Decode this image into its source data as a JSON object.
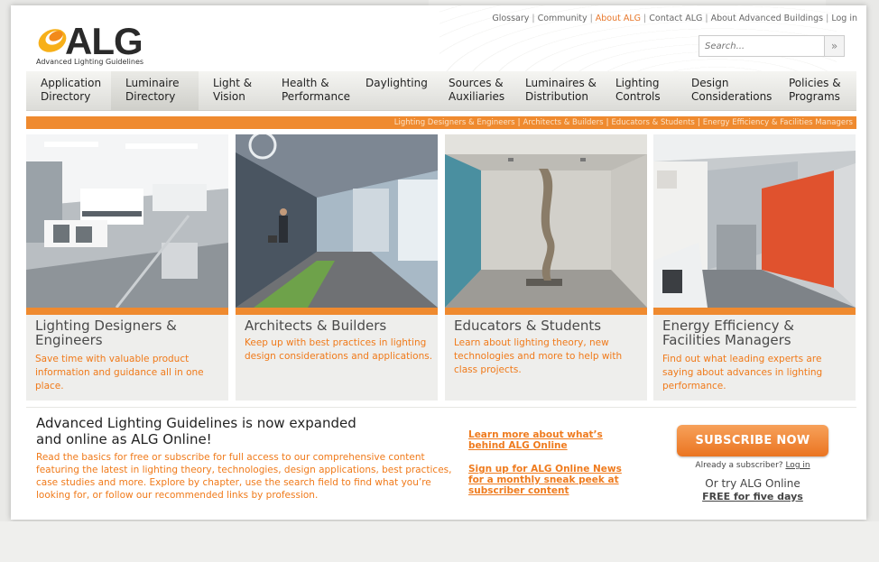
{
  "logo": {
    "text": "ALG",
    "subtitle": "Advanced Lighting Guidelines"
  },
  "util_links": [
    {
      "label": "Glossary",
      "active": false
    },
    {
      "label": "Community",
      "active": false
    },
    {
      "label": "About ALG",
      "active": true
    },
    {
      "label": "Contact ALG",
      "active": false
    },
    {
      "label": "About Advanced Buildings",
      "active": false
    },
    {
      "label": "Log in",
      "active": false
    }
  ],
  "search": {
    "placeholder": "Search...",
    "go_label": "»"
  },
  "nav": [
    "Application\nDirectory",
    "Luminaire\nDirectory",
    "Light &\nVision",
    "Health &\nPerformance",
    "Daylighting",
    "Sources &\nAuxiliaries",
    "Luminaires &\nDistribution",
    "Lighting\nControls",
    "Design\nConsiderations",
    "Policies &\nPrograms"
  ],
  "audience": [
    "Lighting Designers & Engineers",
    "Architects & Builders",
    "Educators & Students",
    "Energy Efficiency & Facilities Managers"
  ],
  "cards": [
    {
      "title": "Lighting Designers &\nEngineers",
      "desc": "Save time with valuable product information and guidance all in one place."
    },
    {
      "title": "Architects & Builders",
      "desc": "Keep up with best practices in lighting design considerations and applications."
    },
    {
      "title": "Educators & Students",
      "desc": "Learn about lighting theory, new technologies and more to help with class projects."
    },
    {
      "title": "Energy Efficiency &\nFacilities Managers",
      "desc": "Find out what leading experts are saying about advances in lighting performance."
    }
  ],
  "promo": {
    "headline": "Advanced Lighting Guidelines is now expanded\nand online as ALG Online!",
    "body": "Read the basics for free or subscribe for full access to our comprehensive content featuring the latest in lighting theory, technologies, design applications, best practices, case studies and more. Explore by chapter, use the search field to find what you’re looking for, or follow our recommended links by profession.",
    "link1": "Learn more about what’s\nbehind ALG Online",
    "link2": "Sign up for ALG Online News\nfor a monthly sneak peek at\nsubscriber content"
  },
  "subscribe": {
    "button": "SUBSCRIBE NOW",
    "already": "Already a subscriber?",
    "login": "Log in",
    "try": "Or try ALG Online",
    "free": "FREE for five days"
  },
  "colors": {
    "accent": "#ef8a2f",
    "link": "#f07a1a"
  }
}
